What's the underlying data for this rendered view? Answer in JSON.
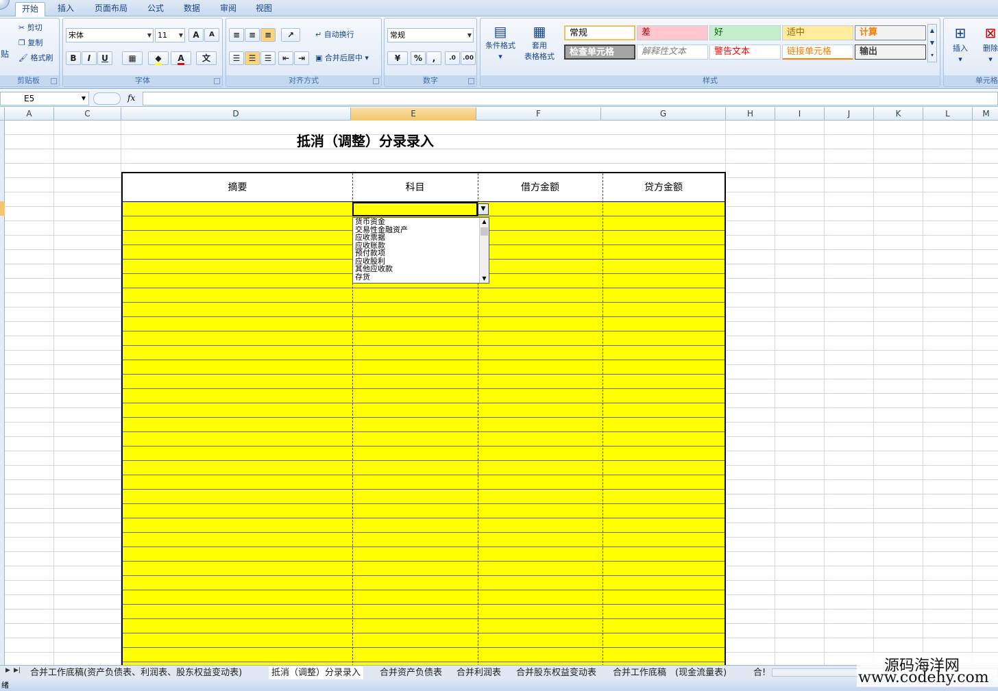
{
  "ribbon_tabs": [
    "开始",
    "插入",
    "页面布局",
    "公式",
    "数据",
    "审阅",
    "视图"
  ],
  "clipboard": {
    "paste": "贴",
    "cut": "剪切",
    "copy": "复制",
    "format_painter": "格式刷",
    "group": "剪贴板"
  },
  "font": {
    "name": "宋体",
    "size": "11",
    "group": "字体",
    "bold": "B",
    "italic": "I",
    "underline": "U",
    "grow": "A",
    "shrink": "A",
    "color": "A",
    "phonetic": "文"
  },
  "alignment": {
    "wrap": "自动换行",
    "merge": "合并后居中",
    "group": "对齐方式"
  },
  "number": {
    "format": "常规",
    "percent": "%",
    "comma": ",",
    "group": "数字"
  },
  "styles": {
    "conditional": "条件格式",
    "table_line1": "套用",
    "table_line2": "表格格式",
    "group": "样式",
    "cells": [
      "常规",
      "差",
      "好",
      "适中",
      "计算",
      "检查单元格",
      "解释性文本",
      "警告文本",
      "链接单元格",
      "输出"
    ]
  },
  "cells_group": {
    "insert": "插入",
    "delete": "删除",
    "group": "单元格"
  },
  "formula_bar": {
    "name_box": "E5",
    "fx": "fx",
    "value": ""
  },
  "columns": [
    "A",
    "C",
    "D",
    "E",
    "F",
    "G",
    "H",
    "I",
    "J",
    "K",
    "L",
    "M"
  ],
  "sheet": {
    "title": "抵消（调整）分录录入",
    "headers": [
      "摘要",
      "科目",
      "借方金额",
      "贷方金额"
    ],
    "dropdown_items": [
      "货币资金",
      "交易性金融资产",
      "应收票据",
      "应收账款",
      "预付款项",
      "应收股利",
      "其他应收款",
      "存货"
    ]
  },
  "sheet_tabs": [
    "合并工作底稿(资产负债表、利润表、股东权益变动表)",
    "抵消（调整）分录录入",
    "合并资产负债表",
    "合并利润表",
    "合并股东权益变动表",
    "合并工作底稿　(现金流量表)",
    "合!"
  ],
  "active_sheet_index": 1,
  "status": "绪",
  "watermark": {
    "line1": "源码海洋网",
    "line2": "www.codehy.com"
  }
}
